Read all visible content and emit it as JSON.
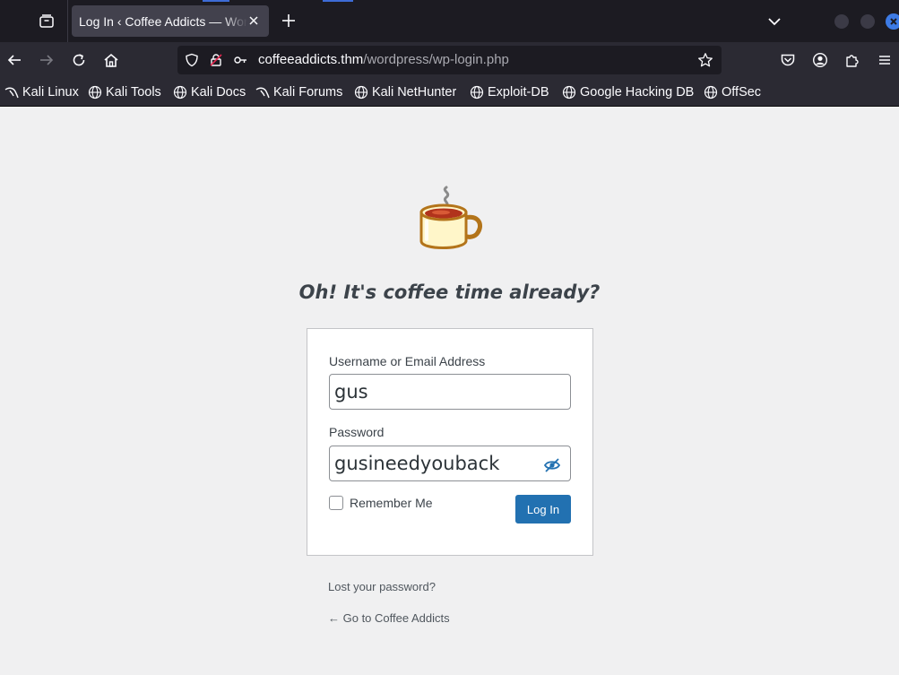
{
  "browser": {
    "tab_title": "Log In ‹ Coffee Addicts — WordPress",
    "url_host": "coffeeaddicts.thm",
    "url_path": "/wordpress/wp-login.php",
    "accent_color": "#3d7be5"
  },
  "bookmarks": [
    {
      "label": "Kali Linux",
      "icon": "kali-dragon-icon"
    },
    {
      "label": "Kali Tools",
      "icon": "globe-icon"
    },
    {
      "label": "Kali Docs",
      "icon": "globe-icon"
    },
    {
      "label": "Kali Forums",
      "icon": "kali-dragon-icon"
    },
    {
      "label": "Kali NetHunter",
      "icon": "globe-icon"
    },
    {
      "label": "Exploit-DB",
      "icon": "globe-icon"
    },
    {
      "label": "Google Hacking DB",
      "icon": "globe-icon"
    },
    {
      "label": "OffSec",
      "icon": "globe-icon"
    }
  ],
  "login": {
    "tagline": "Oh! It's coffee time already?",
    "username_label": "Username or Email Address",
    "username_value": "gus",
    "password_label": "Password",
    "password_value": "gusineedyouback",
    "remember_label": "Remember Me",
    "remember_checked": false,
    "submit_label": "Log In",
    "button_color": "#2271b1"
  },
  "links": {
    "lost_password": "Lost your password?",
    "back_to_site": "← Go to Coffee Addicts"
  }
}
